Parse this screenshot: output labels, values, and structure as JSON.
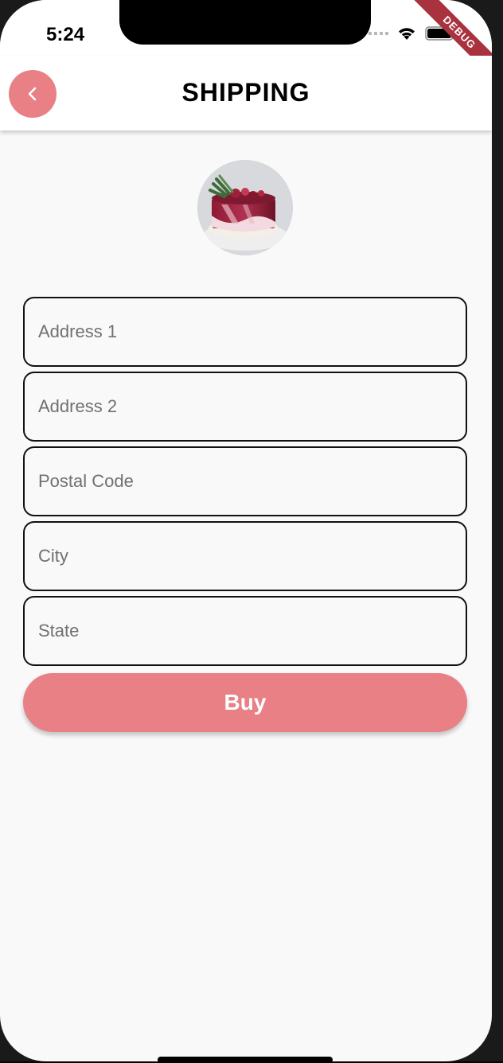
{
  "status": {
    "time": "5:24",
    "debug_label": "DEBUG"
  },
  "appbar": {
    "title": "SHIPPING",
    "back_icon": "chevron-left-icon"
  },
  "avatar": {
    "icon": "cake-image"
  },
  "form": {
    "address1_placeholder": "Address 1",
    "address2_placeholder": "Address 2",
    "postal_placeholder": "Postal Code",
    "city_placeholder": "City",
    "state_placeholder": "State"
  },
  "buy": {
    "label": "Buy"
  },
  "colors": {
    "accent": "#e88086",
    "background": "#f9f9f9",
    "border": "#111111",
    "debug": "#a8323e"
  }
}
